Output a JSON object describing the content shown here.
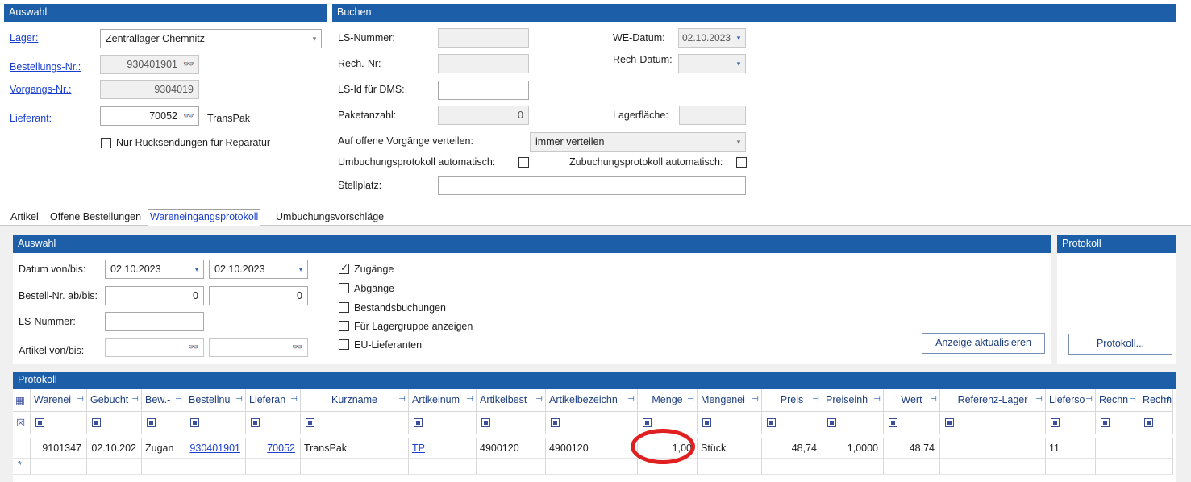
{
  "auswahl_top": {
    "title": "Auswahl",
    "lager_label": "Lager:",
    "lager_value": "Zentrallager Chemnitz",
    "bestellnr_label": "Bestellungs-Nr.:",
    "bestellnr_value": "930401901",
    "vorgangsnr_label": "Vorgangs-Nr.:",
    "vorgangsnr_value": "9304019",
    "lieferant_label": "Lieferant:",
    "lieferant_value": "70052",
    "lieferant_name": "TransPak",
    "rueck_label": "Nur Rücksendungen für Reparatur"
  },
  "buchen": {
    "title": "Buchen",
    "ls_nummer_label": "LS-Nummer:",
    "rech_nr_label": "Rech.-Nr:",
    "ls_id_label": "LS-Id für DMS:",
    "paketanzahl_label": "Paketanzahl:",
    "paketanzahl_value": "0",
    "verteilen_label": "Auf offene Vorgänge verteilen:",
    "verteilen_value": "immer verteilen",
    "umbuchung_label": "Umbuchungsprotokoll automatisch:",
    "zubuchung_label": "Zubuchungsprotokoll automatisch:",
    "stellplatz_label": "Stellplatz:",
    "we_datum_label": "WE-Datum:",
    "we_datum_value": "02.10.2023",
    "rech_datum_label": "Rech-Datum:",
    "lagerflaeche_label": "Lagerfläche:"
  },
  "tabs": [
    "Artikel",
    "Offene Bestellungen",
    "Wareneingangsprotokoll",
    "Umbuchungsvorschläge"
  ],
  "auswahl_filter": {
    "title": "Auswahl",
    "datum_label": "Datum von/bis:",
    "datum_von": "02.10.2023",
    "datum_bis": "02.10.2023",
    "bestellnr_label": "Bestell-Nr. ab/bis:",
    "bestellnr_von": "0",
    "bestellnr_bis": "0",
    "ls_label": "LS-Nummer:",
    "artikel_label": "Artikel von/bis:",
    "zugaenge": "Zugänge",
    "abgaenge": "Abgänge",
    "bestandsbuchungen": "Bestandsbuchungen",
    "lagergruppe": "Für Lagergruppe anzeigen",
    "eu_lieferanten": "EU-Lieferanten",
    "refresh_button": "Anzeige aktualisieren"
  },
  "protokoll_side": {
    "title": "Protokoll",
    "button": "Protokoll..."
  },
  "grid": {
    "title": "Protokoll",
    "headers": [
      "Warenei",
      "Gebucht",
      "Bew.-",
      "Bestellnu",
      "Lieferan",
      "Kurzname",
      "Artikelnum",
      "Artikelbest",
      "Artikelbezeichn",
      "Menge",
      "Mengenei",
      "Preis",
      "Preiseinh",
      "Wert",
      "Referenz-Lager",
      "Lieferso",
      "Rechn",
      "Rechn"
    ],
    "row": [
      "9101347",
      "02.10.202",
      "Zugan",
      "930401901",
      "70052",
      "TransPak",
      "TP",
      "4900120",
      "4900120",
      "1,00",
      "Stück",
      "48,74",
      "1,0000",
      "48,74",
      "",
      "11",
      "",
      ""
    ]
  }
}
